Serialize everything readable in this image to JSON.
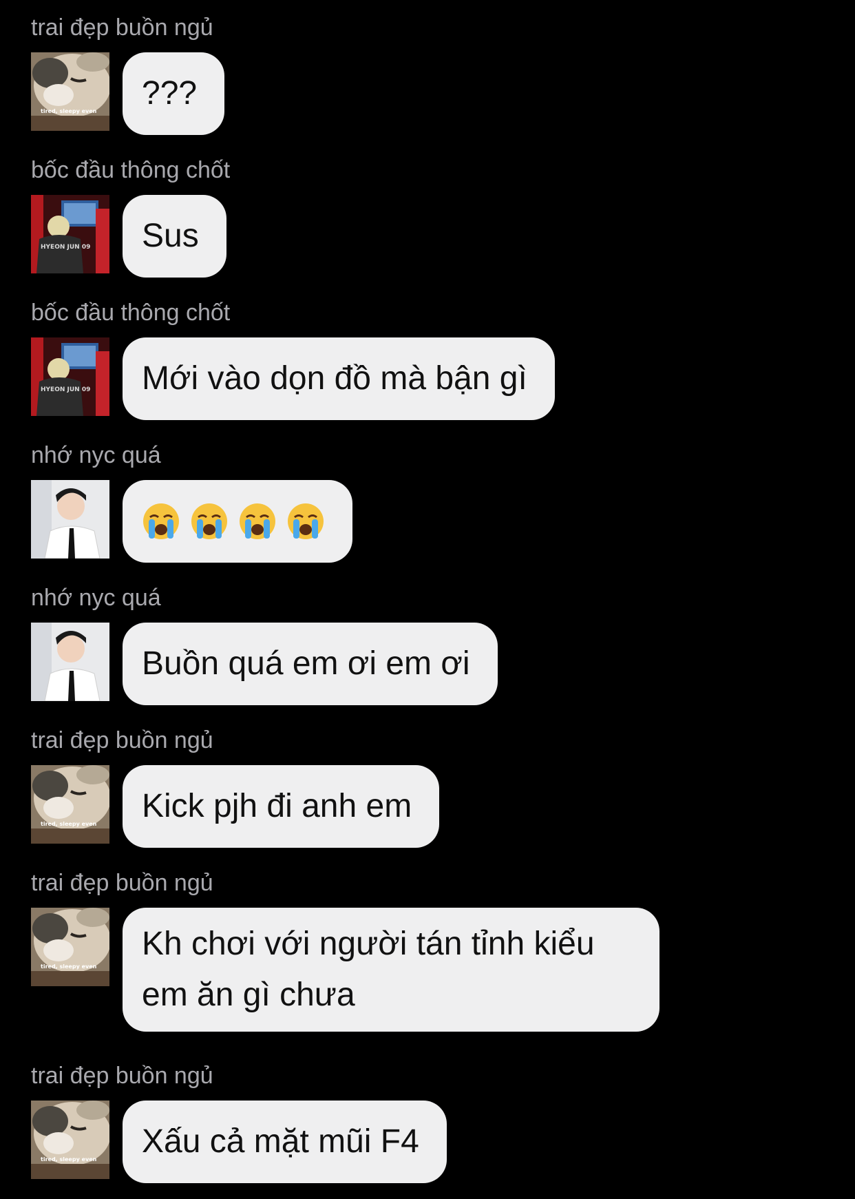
{
  "messages": [
    {
      "sender": "trai đẹp buồn ngủ",
      "avatar": "cat-avatar",
      "avatar_caption": "tired, sleepy even",
      "text": "???"
    },
    {
      "sender": "bốc đầu thông chốt",
      "avatar": "jersey-avatar",
      "avatar_caption": "HYEON JUN 09",
      "text": "Sus"
    },
    {
      "sender": "bốc đầu thông chốt",
      "avatar": "jersey-avatar",
      "avatar_caption": "HYEON JUN 09",
      "text": "Mới vào dọn đồ mà bận gì"
    },
    {
      "sender": "nhớ nyc quá",
      "avatar": "man-avatar",
      "emoji": [
        "loudly-crying-face-icon",
        "loudly-crying-face-icon",
        "loudly-crying-face-icon",
        "loudly-crying-face-icon"
      ]
    },
    {
      "sender": "nhớ nyc quá",
      "avatar": "man-avatar",
      "text": "Buồn quá em ơi em ơi"
    },
    {
      "sender": "trai đẹp buồn ngủ",
      "avatar": "cat-avatar",
      "avatar_caption": "tired, sleepy even",
      "text": "Kick pjh đi anh em"
    },
    {
      "sender": "trai đẹp buồn ngủ",
      "avatar": "cat-avatar",
      "avatar_caption": "tired, sleepy even",
      "text": "Kh chơi với người tán tỉnh kiểu em ăn gì chưa"
    },
    {
      "sender": "trai đẹp buồn ngủ",
      "avatar": "cat-avatar",
      "avatar_caption": "tired, sleepy even",
      "text": "Xấu cả mặt mũi F4"
    }
  ],
  "colors": {
    "background": "#000000",
    "bubble": "#efeff0",
    "sender_name": "#a9a9ae",
    "text": "#111111"
  }
}
